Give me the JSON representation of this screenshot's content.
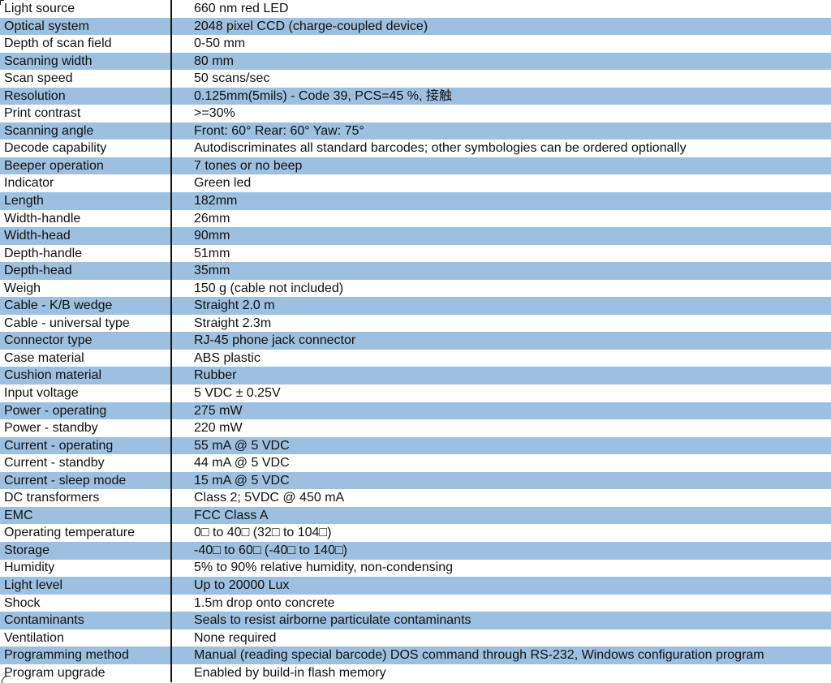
{
  "table": {
    "rows": [
      {
        "label": "Light source",
        "value": "660 nm red LED"
      },
      {
        "label": "Optical system",
        "value": "2048 pixel CCD (charge-coupled device)"
      },
      {
        "label": "Depth of scan field",
        "value": "0-50 mm"
      },
      {
        "label": "Scanning width",
        "value": "80 mm"
      },
      {
        "label": "Scan speed",
        "value": "50 scans/sec"
      },
      {
        "label": "Resolution",
        "value": "0.125mm(5mils) - Code 39, PCS=45 %, 接触"
      },
      {
        "label": "Print contrast",
        "value": ">=30%"
      },
      {
        "label": "Scanning angle",
        "value": "Front: 60° Rear: 60° Yaw: 75°"
      },
      {
        "label": "Decode capability",
        "value": "Autodiscriminates all standard barcodes; other symbologies can be ordered optionally"
      },
      {
        "label": "Beeper operation",
        "value": "7 tones or no beep"
      },
      {
        "label": "Indicator",
        "value": "Green led"
      },
      {
        "label": "Length",
        "value": "182mm"
      },
      {
        "label": "Width-handle",
        "value": "26mm"
      },
      {
        "label": "Width-head",
        "value": "90mm"
      },
      {
        "label": "Depth-handle",
        "value": "51mm"
      },
      {
        "label": "Depth-head",
        "value": "35mm"
      },
      {
        "label": "Weigh",
        "value": "150 g (cable not included)"
      },
      {
        "label": "Cable - K/B wedge",
        "value": "Straight 2.0 m"
      },
      {
        "label": "Cable - universal type",
        "value": "Straight 2.3m"
      },
      {
        "label": "Connector type",
        "value": "RJ-45 phone jack connector"
      },
      {
        "label": "Case material",
        "value": "ABS plastic"
      },
      {
        "label": "Cushion material",
        "value": "Rubber"
      },
      {
        "label": "Input voltage",
        "value": "5 VDC ± 0.25V"
      },
      {
        "label": "Power - operating",
        "value": "275 mW"
      },
      {
        "label": "Power - standby",
        "value": "220 mW"
      },
      {
        "label": "Current - operating",
        "value": "55 mA @ 5 VDC"
      },
      {
        "label": "Current - standby",
        "value": "44 mA @ 5 VDC"
      },
      {
        "label": "Current - sleep mode",
        "value": "15 mA @ 5 VDC"
      },
      {
        "label": "DC transformers",
        "value": "Class 2; 5VDC @ 450 mA"
      },
      {
        "label": "EMC",
        "value": "FCC Class A"
      },
      {
        "label": "Operating temperature",
        "value": "0□ to 40□ (32□ to 104□)"
      },
      {
        "label": "Storage",
        "value": "-40□ to 60□ (-40□ to 140□)"
      },
      {
        "label": "Humidity",
        "value": "5% to 90% relative humidity, non-condensing"
      },
      {
        "label": "Light level",
        "value": "Up to 20000 Lux"
      },
      {
        "label": "Shock",
        "value": "1.5m drop onto concrete"
      },
      {
        "label": "Contaminants",
        "value": "Seals to resist airborne particulate contaminants"
      },
      {
        "label": "Ventilation",
        "value": "None required"
      },
      {
        "label": "Programming method",
        "value": "Manual (reading special barcode) DOS command through RS-232, Windows configuration program"
      },
      {
        "label": "Program upgrade",
        "value": "Enabled by build-in flash memory"
      }
    ]
  },
  "colors": {
    "alt_row": "#9dc0e0",
    "row": "#ffffff",
    "text": "#111111"
  }
}
